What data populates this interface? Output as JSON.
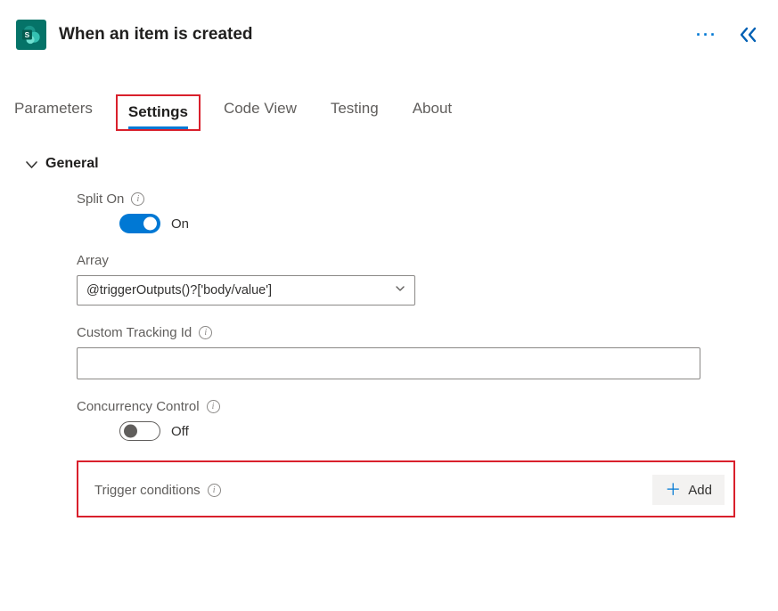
{
  "header": {
    "title": "When an item is created"
  },
  "tabs": [
    {
      "label": "Parameters",
      "active": false
    },
    {
      "label": "Settings",
      "active": true
    },
    {
      "label": "Code View",
      "active": false
    },
    {
      "label": "Testing",
      "active": false
    },
    {
      "label": "About",
      "active": false
    }
  ],
  "general": {
    "section_label": "General",
    "split_on": {
      "label": "Split On",
      "state_label": "On",
      "on": true
    },
    "array": {
      "label": "Array",
      "value": "@triggerOutputs()?['body/value']"
    },
    "custom_tracking_id": {
      "label": "Custom Tracking Id",
      "value": ""
    },
    "concurrency_control": {
      "label": "Concurrency Control",
      "state_label": "Off",
      "on": false
    },
    "trigger_conditions": {
      "label": "Trigger conditions",
      "add_label": "Add"
    }
  }
}
